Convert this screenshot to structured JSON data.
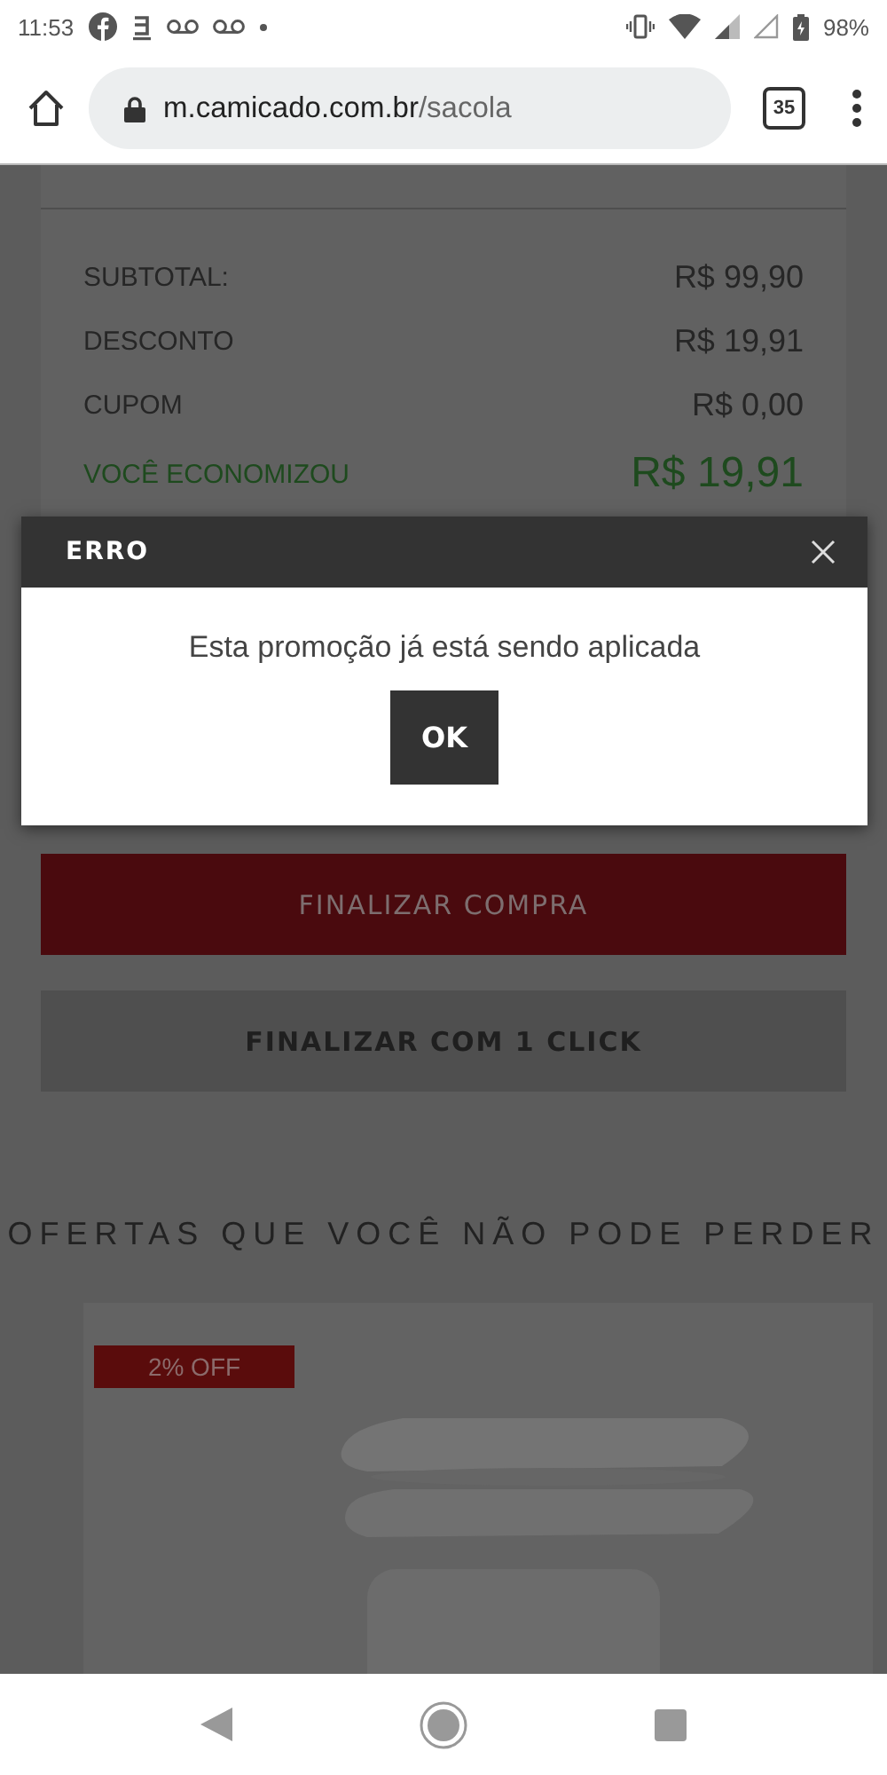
{
  "status_bar": {
    "time": "11:53",
    "battery": "98%"
  },
  "browser": {
    "url_host": "m.camicado.com.br",
    "url_path": "/sacola",
    "tab_count": "35"
  },
  "summary": {
    "rows": [
      {
        "label": "SUBTOTAL:",
        "value": "R$ 99,90",
        "kind": "normal"
      },
      {
        "label": "DESCONTO",
        "value": "R$ 19,91",
        "kind": "normal"
      },
      {
        "label": "CUPOM",
        "value": "R$ 0,00",
        "kind": "normal"
      },
      {
        "label": "VOCÊ ECONOMIZOU",
        "value": "R$ 19,91",
        "kind": "savings"
      }
    ]
  },
  "buttons": [
    {
      "label": "FINALIZAR COMPRA",
      "kind": "primary"
    },
    {
      "label": "FINALIZAR COM 1 CLICK",
      "kind": "secondary"
    }
  ],
  "offers": {
    "title": "OFERTAS QUE VOCÊ NÃO PODE PERDER",
    "products": [
      {
        "badge": "2% OFF",
        "kind": "picture"
      }
    ]
  },
  "dialog": {
    "title": "ERRO",
    "message": "Esta promoção já está sendo aplicada",
    "button": "OK"
  }
}
